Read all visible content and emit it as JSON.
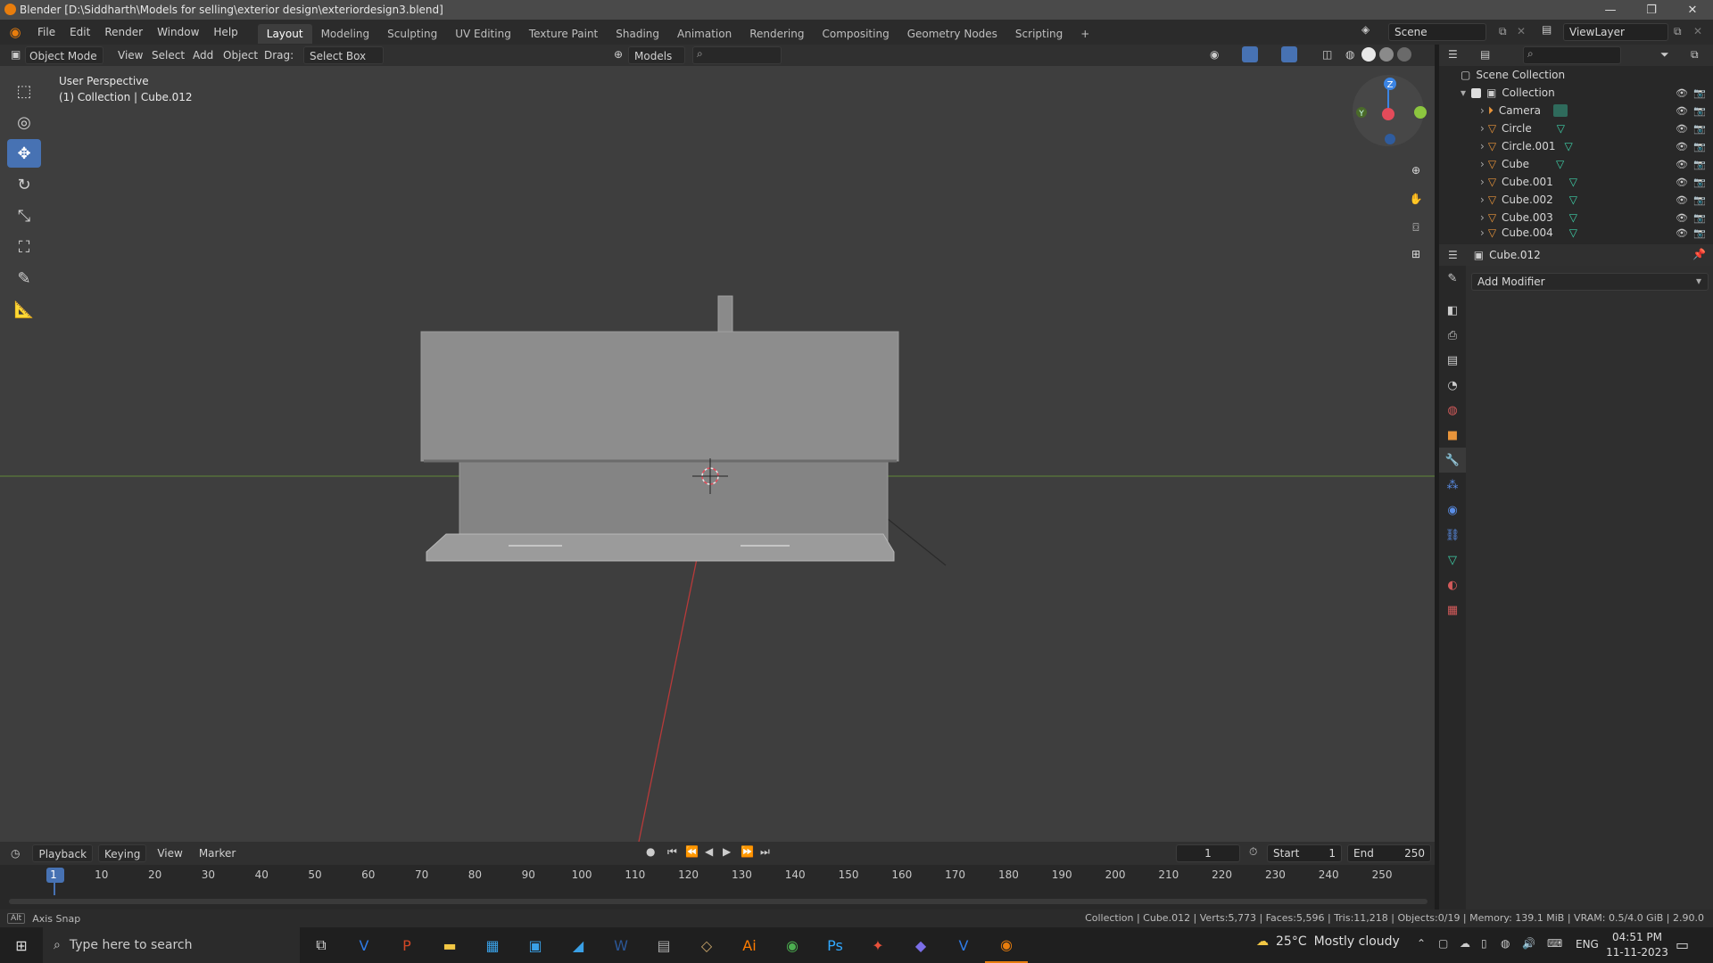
{
  "window": {
    "title": "Blender [D:\\Siddharth\\Models for selling\\exterior design\\exteriordesign3.blend]",
    "minimize": "—",
    "maximize": "❐",
    "close": "✕"
  },
  "menubar": {
    "menus": [
      "File",
      "Edit",
      "Render",
      "Window",
      "Help"
    ],
    "workspaces": [
      "Layout",
      "Modeling",
      "Sculpting",
      "UV Editing",
      "Texture Paint",
      "Shading",
      "Animation",
      "Rendering",
      "Compositing",
      "Geometry Nodes",
      "Scripting"
    ],
    "active_workspace": "Layout",
    "add_workspace": "+",
    "scene_label": "Scene",
    "viewlayer_label": "ViewLayer"
  },
  "viewport_header": {
    "mode": "Object Mode",
    "items": [
      "View",
      "Select",
      "Add",
      "Object"
    ],
    "drag_label": "Drag:",
    "drag_value": "Select Box",
    "orientation": "Models"
  },
  "viewport": {
    "view_name": "User Perspective",
    "collection_info": "(1) Collection | Cube.012",
    "gizmo_axes": [
      "X",
      "Y",
      "Z"
    ],
    "colors": {
      "background": "#3e3e3e",
      "grid": "#474747",
      "x_axis": "#c23b3b",
      "y_axis": "#6e9b35",
      "model": "#8a8a8a",
      "gizmo_x": "#e34b5a",
      "gizmo_y": "#8cc63f",
      "gizmo_z": "#3b84e3"
    }
  },
  "tools": [
    "select-box",
    "cursor",
    "move",
    "rotate",
    "scale",
    "transform",
    "annotate",
    "measure"
  ],
  "active_tool": "move",
  "outliner": {
    "root": "Scene Collection",
    "collection": "Collection",
    "items": [
      "Camera",
      "Circle",
      "Circle.001",
      "Cube",
      "Cube.001",
      "Cube.002",
      "Cube.003",
      "Cube.004"
    ]
  },
  "properties": {
    "object_name": "Cube.012",
    "add_modifier": "Add Modifier"
  },
  "timeline": {
    "menus": [
      "Playback",
      "Keying",
      "View",
      "Marker"
    ],
    "current_frame": "1",
    "start_label": "Start",
    "start_value": "1",
    "end_label": "End",
    "end_value": "250",
    "ticks": [
      "1",
      "10",
      "20",
      "30",
      "40",
      "50",
      "60",
      "70",
      "80",
      "90",
      "100",
      "110",
      "120",
      "130",
      "140",
      "150",
      "160",
      "170",
      "180",
      "190",
      "200",
      "210",
      "220",
      "230",
      "240",
      "250"
    ]
  },
  "statusbar": {
    "left_key": "Alt",
    "left_hint": "Axis Snap",
    "stats": "Collection | Cube.012 | Verts:5,773 | Faces:5,596 | Tris:11,218 | Objects:0/19 | Memory: 139.1 MiB | VRAM: 0.5/4.0 GiB | 2.90.0"
  },
  "taskbar": {
    "search_placeholder": "Type here to search",
    "weather_temp": "25°C",
    "weather_text": "Mostly cloudy",
    "language": "ENG",
    "time": "04:51 PM",
    "date": "11-11-2023",
    "apps": [
      "task-view",
      "veeam",
      "powerpoint",
      "file-explorer",
      "calculator",
      "store",
      "edge",
      "word",
      "system",
      "sketchup",
      "illustrator",
      "chrome",
      "photoshop",
      "figma",
      "vs-code",
      "vlc",
      "blender"
    ]
  }
}
